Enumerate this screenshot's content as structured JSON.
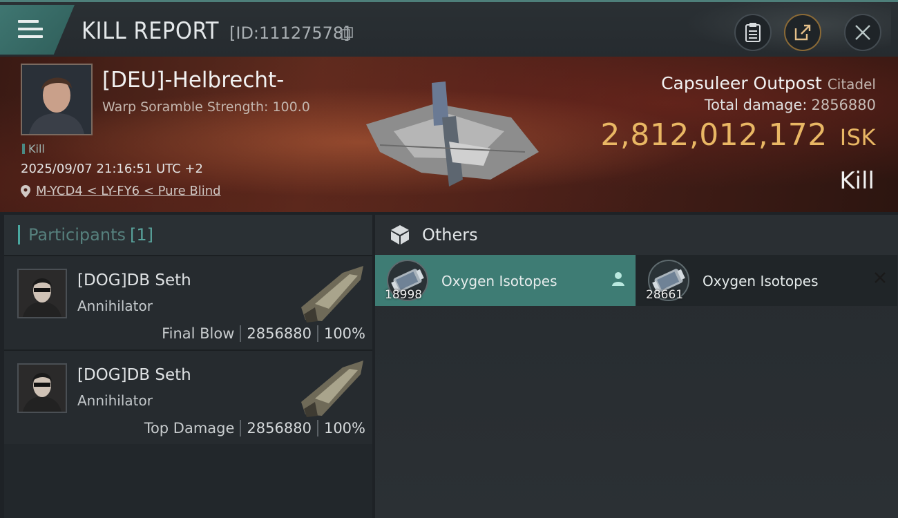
{
  "header": {
    "title": "KILL REPORT",
    "report_id": "[ID:11127578]",
    "icons": [
      "menu-icon",
      "copy-icon",
      "clipboard-icon",
      "share-icon",
      "close-icon"
    ]
  },
  "victim": {
    "name": "[DEU]-Helbrecht-",
    "warp_scramble": "Warp Soramble Strength: 100.0",
    "kill_tag": "Kill",
    "timestamp": "2025/09/07 21:16:51 UTC +2",
    "location": "M-YCD4 < LY-FY6 < Pure Blind"
  },
  "target": {
    "structure": "Capsuleer Outpost",
    "structure_class": "Citadel",
    "total_damage_label": "Total damage:",
    "total_damage_value": "2856880",
    "isk_value": "2,812,012,172",
    "isk_unit": "ISK",
    "result": "Kill"
  },
  "participants": {
    "title": "Participants",
    "count": "[1]",
    "rows": [
      {
        "name": "[DOG]DB Seth",
        "ship": "Annihilator",
        "role": "Final Blow",
        "damage": "2856880",
        "percent": "100%"
      },
      {
        "name": "[DOG]DB Seth",
        "ship": "Annihilator",
        "role": "Top Damage",
        "damage": "2856880",
        "percent": "100%"
      }
    ]
  },
  "others": {
    "title": "Others",
    "items": [
      {
        "name": "Oxygen Isotopes",
        "quantity": "18998",
        "selected": true
      },
      {
        "name": "Oxygen Isotopes",
        "quantity": "28661",
        "selected": false
      }
    ]
  },
  "colors": {
    "accent_teal": "#3e7c74",
    "isk_gold": "#e9b764",
    "banner_red": "#5d2b1e"
  }
}
